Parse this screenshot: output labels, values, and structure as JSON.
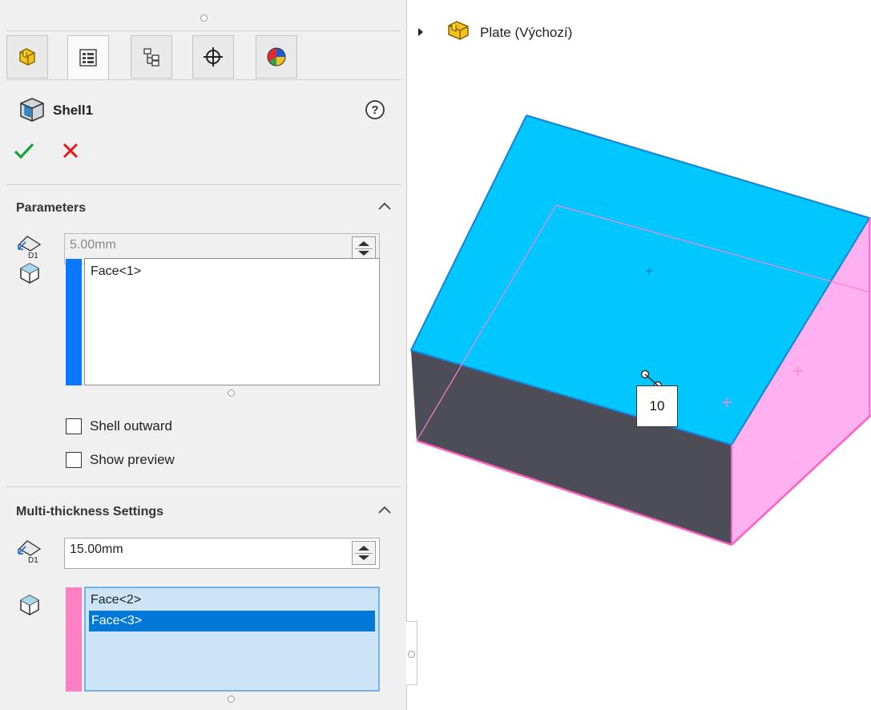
{
  "tabs": [
    {
      "name": "feature-manager",
      "active": false
    },
    {
      "name": "property-manager",
      "active": true
    },
    {
      "name": "configuration-manager",
      "active": false
    },
    {
      "name": "dimxpert-manager",
      "active": false
    },
    {
      "name": "display-manager",
      "active": false
    }
  ],
  "feature": {
    "title": "Shell1",
    "help_icon": "help-icon",
    "ok_icon": "check-icon",
    "cancel_icon": "x-icon"
  },
  "parameters": {
    "title": "Parameters",
    "thickness_value": "5.00mm",
    "faces": [
      "Face<1>"
    ],
    "shell_outward_label": "Shell outward",
    "shell_outward_checked": false,
    "show_preview_label": "Show preview",
    "show_preview_checked": false
  },
  "multi_thickness": {
    "title": "Multi-thickness Settings",
    "thickness_value": "15.00mm",
    "faces": [
      "Face<2>",
      "Face<3>"
    ],
    "selected_index": 1
  },
  "tree": {
    "part_label": "Plate  (Výchozí)"
  },
  "viewport": {
    "callout_value": "10",
    "colors": {
      "top_face": "#00c8ff",
      "front_face": "#4d4d57",
      "side_face": "#ffb0f0",
      "highlight_edge": "#ff5fbf",
      "selected_list": "#0078d7"
    }
  }
}
